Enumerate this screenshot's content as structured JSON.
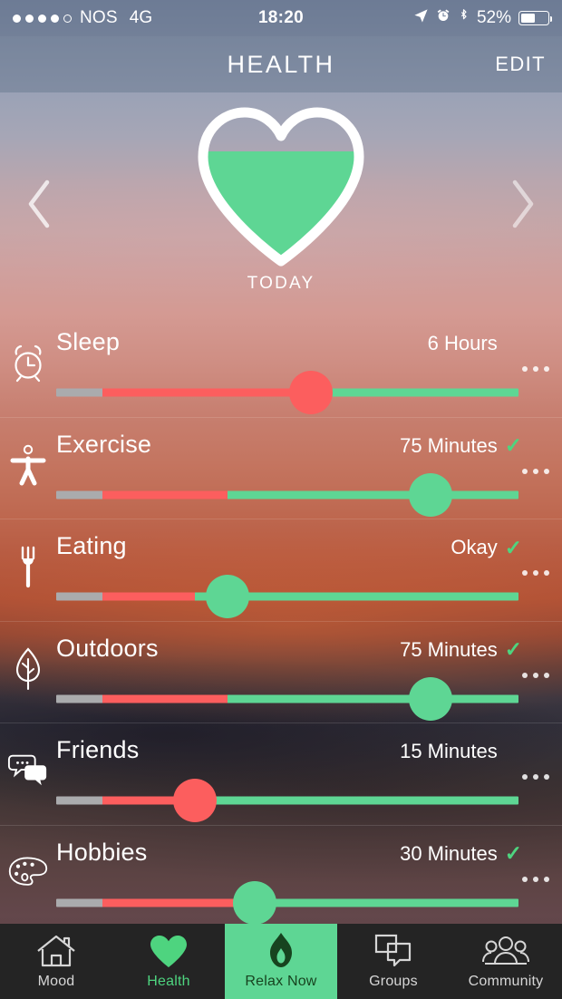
{
  "statusbar": {
    "signal_dots_filled": 4,
    "signal_dots_total": 5,
    "carrier": "NOS",
    "network": "4G",
    "time": "18:20",
    "battery_percent": "52%",
    "battery_level": 52,
    "icons": [
      "location-arrow-icon",
      "alarm-icon",
      "bluetooth-icon"
    ]
  },
  "navbar": {
    "title": "HEALTH",
    "edit_label": "EDIT"
  },
  "hero": {
    "prev_label": "previous day",
    "next_label": "next day",
    "day_label": "TODAY",
    "heart_fill_percent": 70,
    "heart_fill_color": "#5ed694"
  },
  "rows": [
    {
      "icon": "alarm-clock-icon",
      "label": "Sleep",
      "value": "6 Hours",
      "checked": false,
      "gray_percent": 10,
      "red_percent": 55,
      "thumb_percent": 55,
      "thumb_color": "red"
    },
    {
      "icon": "person-icon",
      "label": "Exercise",
      "value": "75 Minutes",
      "checked": true,
      "gray_percent": 10,
      "red_percent": 37,
      "thumb_percent": 81,
      "thumb_color": "green"
    },
    {
      "icon": "fork-icon",
      "label": "Eating",
      "value": "Okay",
      "checked": true,
      "gray_percent": 10,
      "red_percent": 30,
      "thumb_percent": 37,
      "thumb_color": "green"
    },
    {
      "icon": "leaf-icon",
      "label": "Outdoors",
      "value": "75 Minutes",
      "checked": true,
      "gray_percent": 10,
      "red_percent": 37,
      "thumb_percent": 81,
      "thumb_color": "green"
    },
    {
      "icon": "speech-bubbles-icon",
      "label": "Friends",
      "value": "15 Minutes",
      "checked": false,
      "gray_percent": 10,
      "red_percent": 30,
      "thumb_percent": 30,
      "thumb_color": "red"
    },
    {
      "icon": "palette-icon",
      "label": "Hobbies",
      "value": "30 Minutes",
      "checked": true,
      "gray_percent": 10,
      "red_percent": 43,
      "thumb_percent": 43,
      "thumb_color": "green"
    }
  ],
  "tabbar": [
    {
      "icon": "house-icon",
      "label": "Mood",
      "state": "normal"
    },
    {
      "icon": "heart-icon",
      "label": "Health",
      "state": "selected"
    },
    {
      "icon": "flame-icon",
      "label": "Relax Now",
      "state": "highlighted"
    },
    {
      "icon": "groups-icon",
      "label": "Groups",
      "state": "normal"
    },
    {
      "icon": "community-icon",
      "label": "Community",
      "state": "normal"
    }
  ],
  "colors": {
    "accent_green": "#5ed694",
    "warn_red": "#fc5e5e",
    "track_gray": "#aaabad",
    "check_green": "#4ed47f",
    "tabbar_bg": "#242424"
  }
}
